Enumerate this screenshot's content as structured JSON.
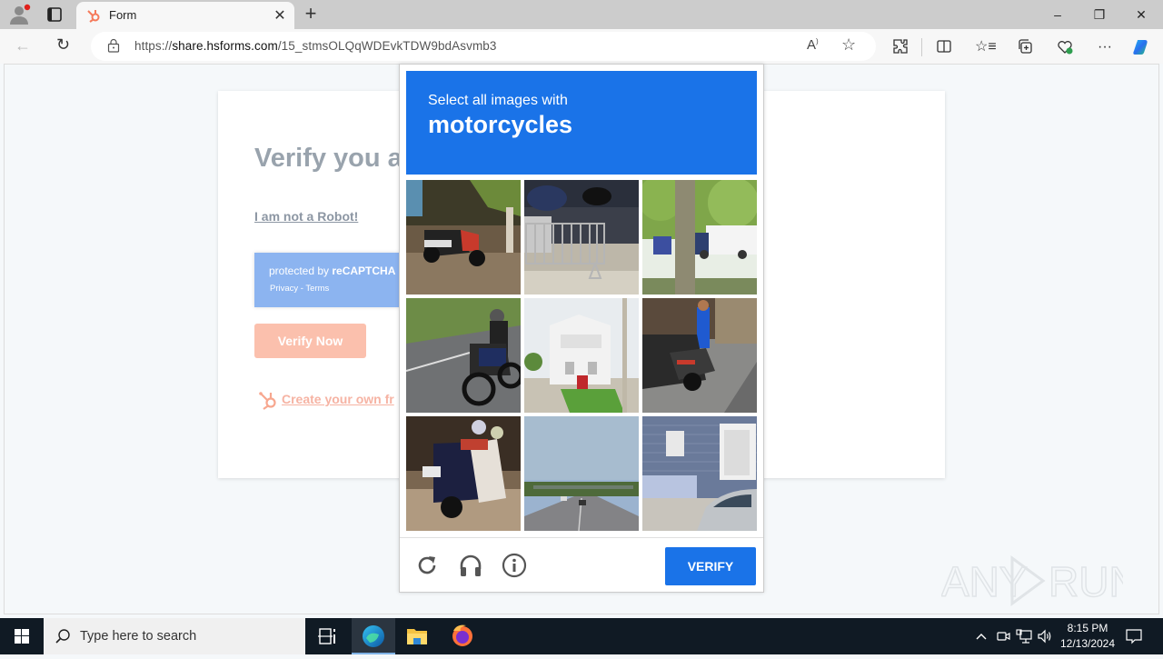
{
  "browser": {
    "tab": {
      "title": "Form",
      "favicon": "hubspot-sprocket-icon"
    },
    "new_tab_label": "+",
    "window_controls": {
      "minimize": "–",
      "restore": "❐",
      "close": "✕"
    },
    "address_bar": {
      "url_prefix": "https://",
      "url_domain": "share.hsforms.com",
      "url_path": "/15_stmsOLQqWDEvkTDW9bdAsvmb3"
    },
    "toolbar_icons": [
      "read-aloud-icon",
      "favorite-star-icon",
      "extensions-icon",
      "split-screen-icon",
      "favorites-icon",
      "collections-icon",
      "browser-essentials-icon",
      "more-icon",
      "copilot-icon"
    ]
  },
  "form": {
    "heading": "Verify you a",
    "robot_link": "I am not a Robot!",
    "recaptcha_badge": {
      "protected_by": "protected by ",
      "brand": "reCAPTCHA",
      "links": "Privacy - Terms"
    },
    "verify_now_label": "Verify Now",
    "create_link": "Create your own fr"
  },
  "captcha": {
    "instruction": "Select all images with",
    "target": "motorcycles",
    "tiles": [
      {
        "desc": "scooter parked under trees",
        "selected": false
      },
      {
        "desc": "metal barrier on sidewalk",
        "selected": false
      },
      {
        "desc": "tree trunk with truck",
        "selected": false
      },
      {
        "desc": "rider on motorcycle",
        "selected": false
      },
      {
        "desc": "white house",
        "selected": false
      },
      {
        "desc": "parked motorcycles on street",
        "selected": false
      },
      {
        "desc": "blurry parked motorbike",
        "selected": false
      },
      {
        "desc": "highway road",
        "selected": false
      },
      {
        "desc": "blue house with car",
        "selected": false
      }
    ],
    "footer": {
      "reload_icon": "reload-icon",
      "audio_icon": "headphones-icon",
      "info_icon": "info-icon",
      "verify_label": "VERIFY"
    },
    "accent_color": "#1a73e8"
  },
  "watermark": {
    "text_left": "ANY",
    "text_right": "RUN"
  },
  "taskbar": {
    "search_placeholder": "Type here to search",
    "apps": [
      "task-view-icon",
      "edge-icon",
      "file-explorer-icon",
      "firefox-icon"
    ],
    "time": "8:15 PM",
    "date": "12/13/2024"
  }
}
